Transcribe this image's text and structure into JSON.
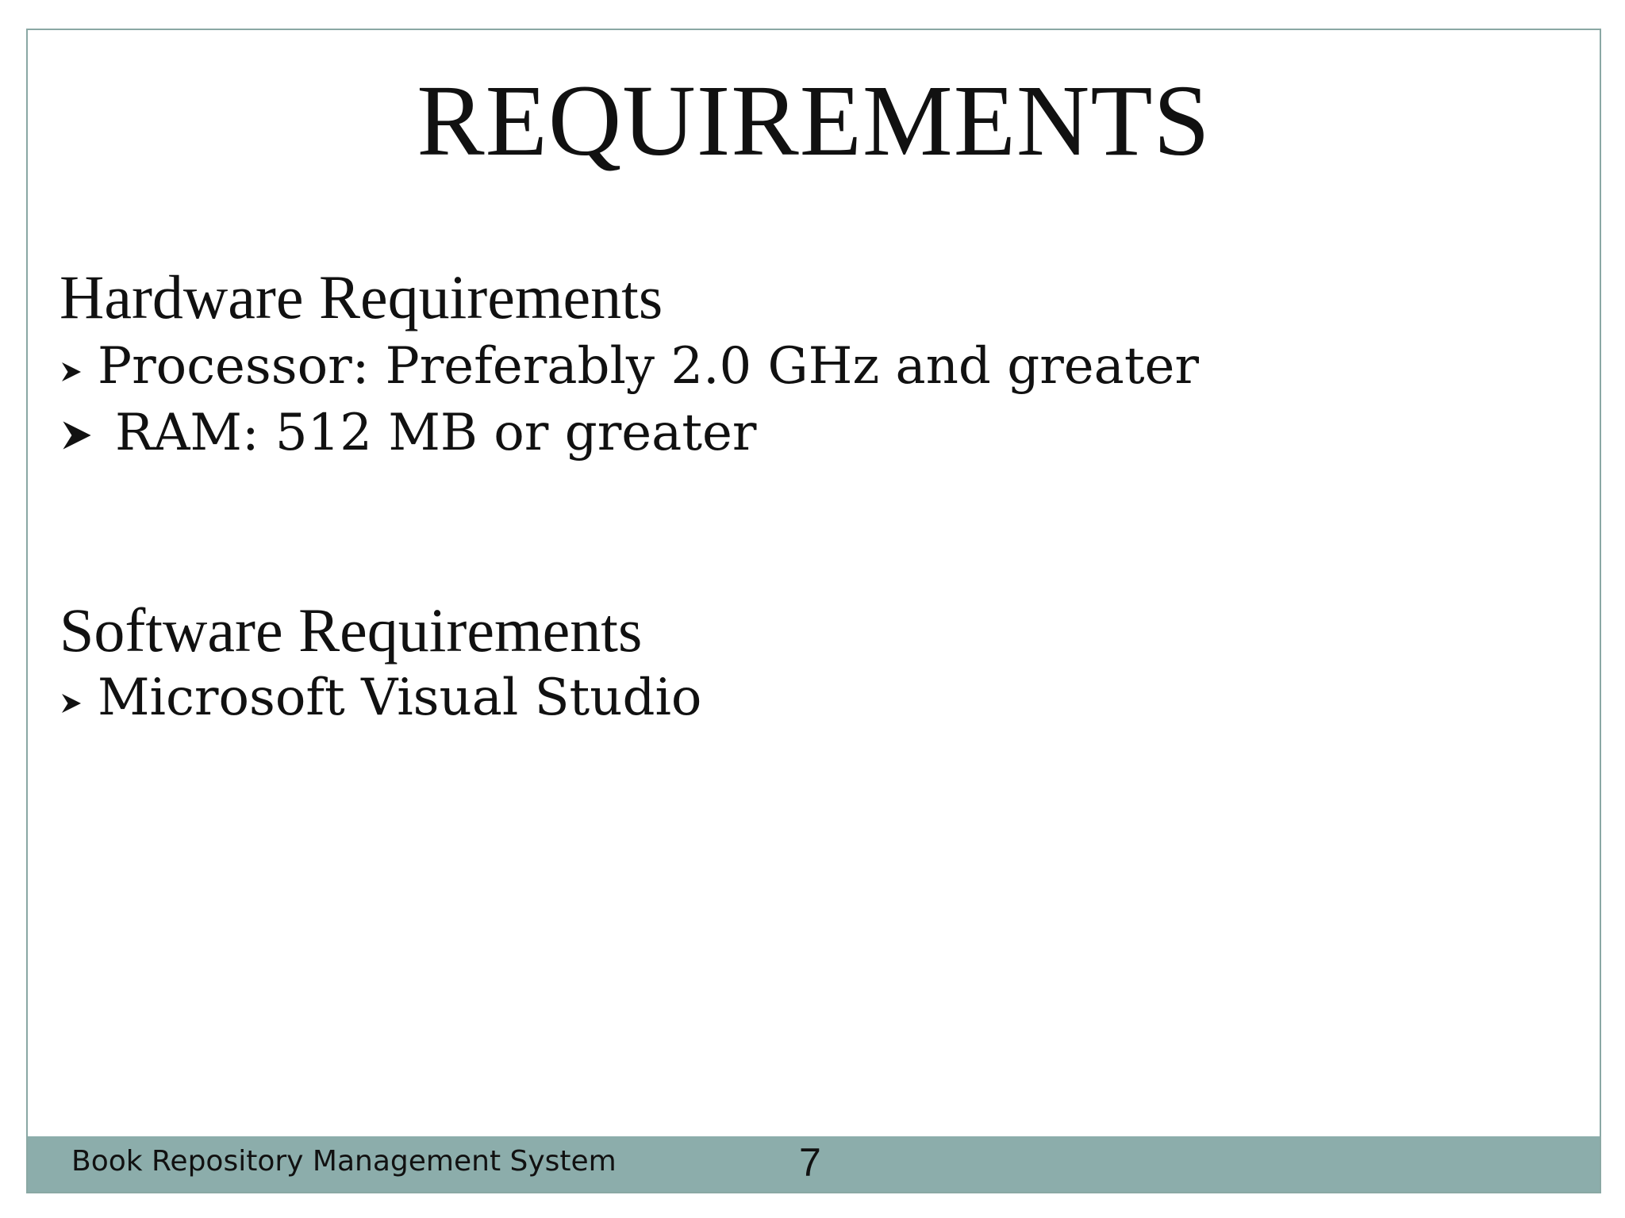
{
  "slide": {
    "title": "REQUIREMENTS",
    "hardware": {
      "heading": "Hardware Requirements",
      "items": [
        "Processor: Preferably 2.0 GHz and greater",
        "RAM: 512 MB or greater"
      ]
    },
    "software": {
      "heading": "Software Requirements",
      "items": [
        "Microsoft Visual Studio"
      ]
    },
    "footer": {
      "text": "Book Repository Management System",
      "page_number": "7"
    },
    "bullet_icon": "arrowhead-bullet-icon",
    "colors": {
      "border": "#8aa8a4",
      "footer_band": "#8cadab",
      "text": "#111111"
    }
  }
}
